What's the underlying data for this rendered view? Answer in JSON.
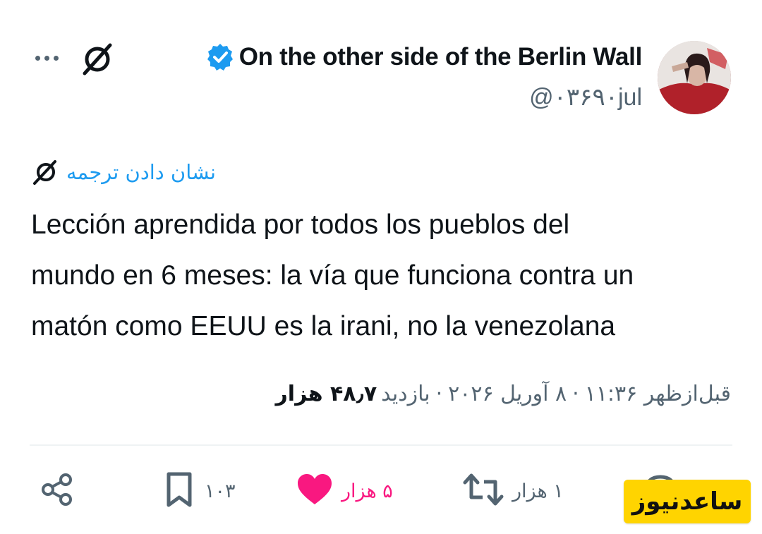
{
  "author": {
    "display_name": "On the other side of the Berlin Wall",
    "handle": "@۰۳۶۹۰jul",
    "verified": true
  },
  "translate": {
    "label": "نشان دادن ترجمه"
  },
  "tweet": {
    "text": "Lección aprendida por todos los pueblos del\nmundo en 6 meses: la vía que funciona contra un\nmatón como EEUU es la irani, no la venezolana"
  },
  "meta": {
    "time": "قبل‌ازظهر ۱۱:۳۶",
    "date": "۸ آوریل ۲۰۲۶",
    "views_count": "۴۸٫۷ هزار",
    "views_label": "بازدید"
  },
  "actions": {
    "retweets": "۱ هزار",
    "likes": "۵ هزار",
    "bookmarks": "۱۰۳"
  },
  "watermark": {
    "text": "ساعدنیوز"
  },
  "colors": {
    "accent": "#1d9bf0",
    "like": "#f91880",
    "muted": "#536471",
    "watermark_bg": "#ffd400"
  }
}
